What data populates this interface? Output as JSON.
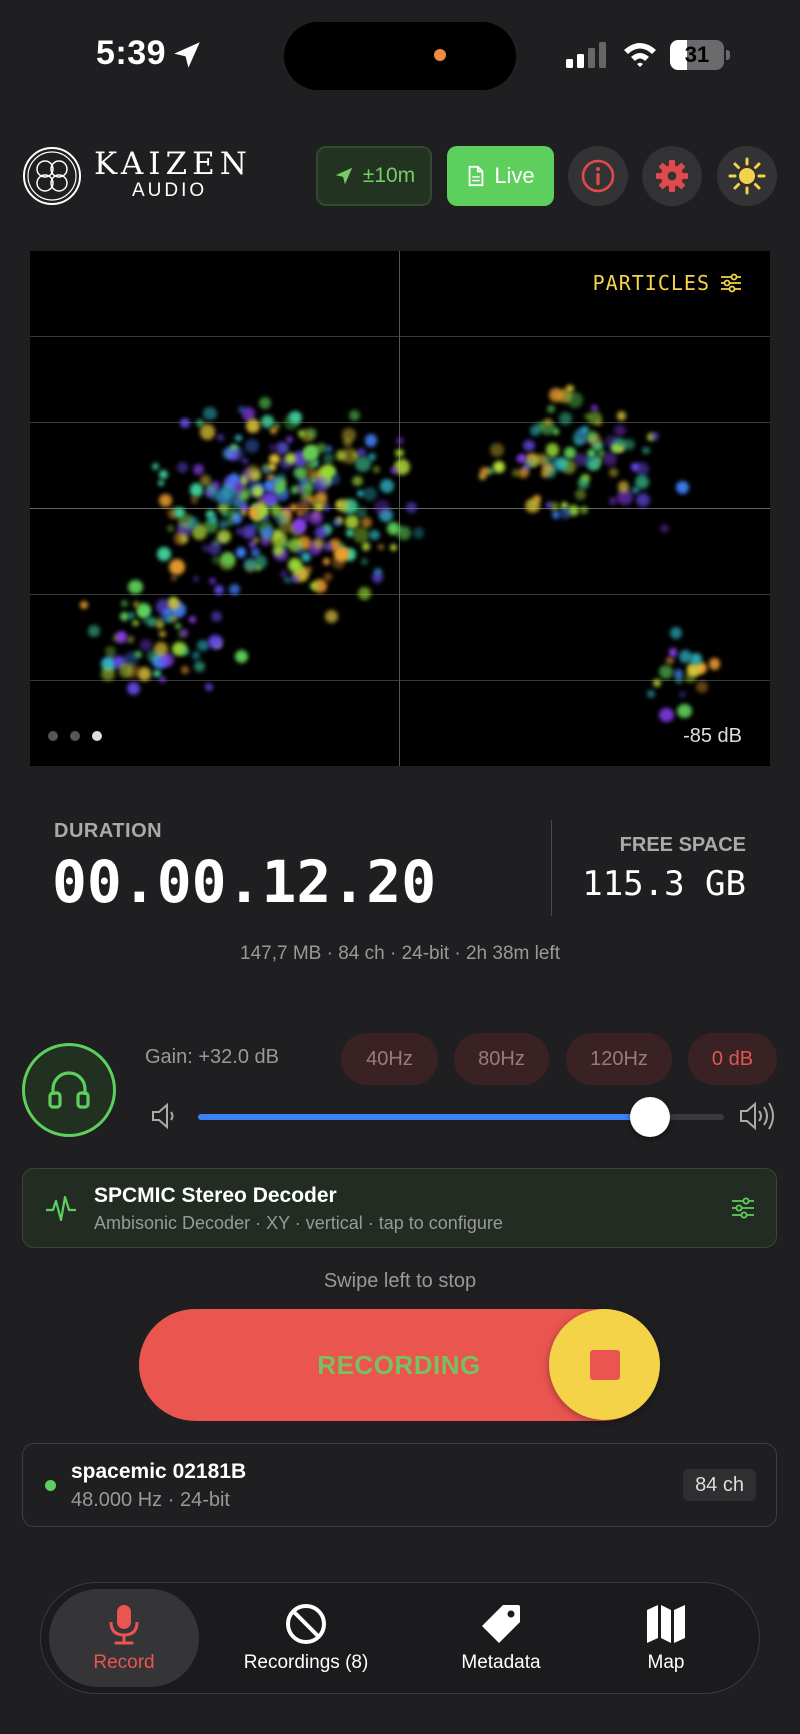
{
  "status_bar": {
    "time": "5:39",
    "battery": "31",
    "battery_level": 0.31
  },
  "header": {
    "logo_title": "KAIZEN",
    "logo_sub": "AUDIO",
    "gps_label": "±10m",
    "live_label": "Live",
    "accent_green": "#5dcf5d",
    "accent_red": "#ea5550"
  },
  "visualizer": {
    "mode_label": "PARTICLES",
    "db_label": "-85 dB",
    "pages": 3,
    "active_page": 3
  },
  "duration": {
    "label": "DURATION",
    "value": "00.00.12.20",
    "free_label": "FREE SPACE",
    "free_value": "115.3 GB",
    "meta": "147,7 MB · 84 ch · 24-bit · 2h 38m left"
  },
  "gain": {
    "label": "Gain: +32.0 dB",
    "chips": [
      "40Hz",
      "80Hz",
      "120Hz",
      "0 dB"
    ],
    "volume_level": 0.86
  },
  "decoder": {
    "title": "SPCMIC Stereo Decoder",
    "subtitle": "Ambisonic Decoder · XY · vertical · tap to configure"
  },
  "record": {
    "hint": "Swipe left to stop",
    "label": "RECORDING"
  },
  "device": {
    "name": "spacemic 02181B",
    "details": "48.000 Hz · 24-bit",
    "channels": "84 ch"
  },
  "tabs": [
    {
      "label": "Record",
      "icon": "mic-icon"
    },
    {
      "label": "Recordings (8)",
      "icon": "prohibited-icon"
    },
    {
      "label": "Metadata",
      "icon": "tag-icon"
    },
    {
      "label": "Map",
      "icon": "map-icon"
    }
  ]
}
